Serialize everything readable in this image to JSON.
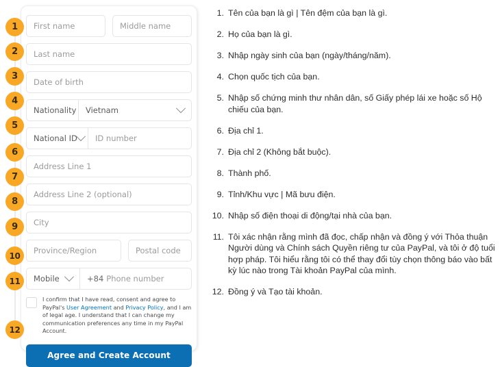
{
  "form": {
    "steps": [
      "1",
      "2",
      "3",
      "4",
      "5",
      "6",
      "7",
      "8",
      "9",
      "10",
      "11",
      "12"
    ],
    "first_name_placeholder": "First name",
    "middle_name_placeholder": "Middle name",
    "last_name_placeholder": "Last name",
    "date_of_birth_placeholder": "Date of birth",
    "nationality_label": "Nationality",
    "nationality_value": "Vietnam",
    "id_type_label": "National ID",
    "id_number_placeholder": "ID number",
    "address_line1_placeholder": "Address Line 1",
    "address_line2_placeholder": "Address Line 2 (optional)",
    "city_placeholder": "City",
    "province_placeholder": "Province/Region",
    "postal_code_placeholder": "Postal code",
    "phone_type_label": "Mobile",
    "phone_country_code": "+84",
    "phone_placeholder": "Phone number",
    "consent": {
      "part1": "I confirm that I have read, consent and agree to PayPal's ",
      "link1": "User Agreement",
      "part2": " and ",
      "link2": "Privacy Policy",
      "part3": ", and I am of legal age. I understand that I can change my communication preferences any time in my PayPal Account."
    },
    "submit_label": "Agree and Create Account"
  },
  "instructions": [
    {
      "num": "1.",
      "text": "Tên của bạn là gì | Tên đệm của bạn là gì."
    },
    {
      "num": "2.",
      "text": "Họ của bạn là gì."
    },
    {
      "num": "3.",
      "text": "Nhập ngày sinh của bạn (ngày/tháng/năm)."
    },
    {
      "num": "4.",
      "text": "Chọn quốc tịch của bạn."
    },
    {
      "num": "5.",
      "text": "Nhập số chứng minh thư nhân dân, số Giấy phép lái xe hoặc số Hộ chiếu của bạn."
    },
    {
      "num": "6.",
      "text": "Địa chỉ 1."
    },
    {
      "num": "7.",
      "text": "Địa chỉ 2 (Không bắt buộc)."
    },
    {
      "num": "8.",
      "text": "Thành phố."
    },
    {
      "num": "9.",
      "text": "Tỉnh/Khu vực | Mã bưu điện."
    },
    {
      "num": "10.",
      "text": "Nhập số điện thoại di động/tại nhà của bạn."
    },
    {
      "num": "11.",
      "text": "Tôi xác nhận rằng mình đã đọc, chấp nhận và đồng ý với Thỏa thuận Người dùng và Chính sách Quyền riêng tư của PayPal, và tôi ở độ tuổi hợp pháp. Tôi hiểu rằng tôi có thể thay đổi tùy chọn thông báo vào bất kỳ lúc nào trong Tài khoản PayPal của mình."
    },
    {
      "num": "12.",
      "text": "Đồng ý và Tạo tài khoản."
    }
  ],
  "colors": {
    "badge": "#f9a826",
    "accent_blue": "#0c6fb4",
    "link_blue": "#0070ba"
  }
}
